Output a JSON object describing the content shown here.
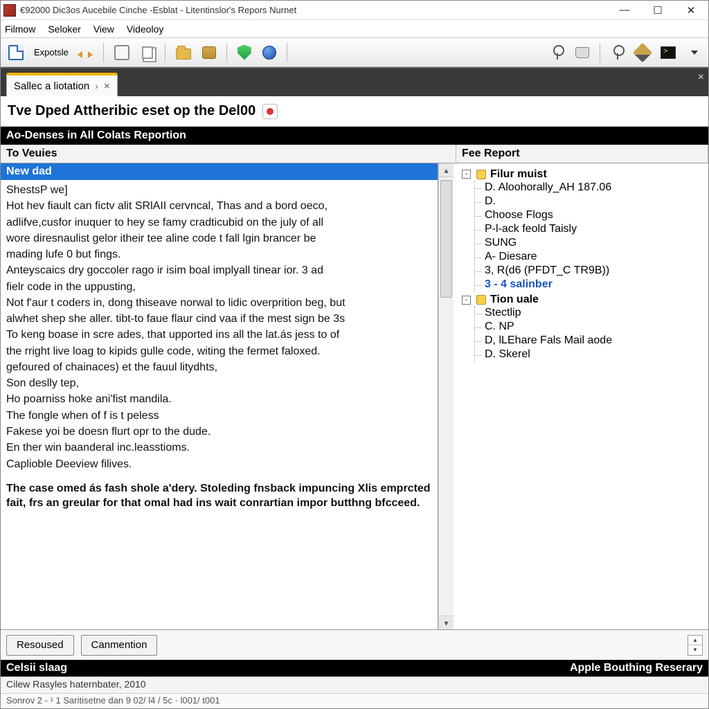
{
  "window": {
    "title": "€92000 Dic3os Aucebile Cinche -Esblat - Litentinslor's Repors Nurnet"
  },
  "menus": [
    "Filmow",
    "Seloker",
    "View",
    "Videoloy"
  ],
  "toolbar": {
    "export_label": "Expotsle"
  },
  "tab": {
    "label": "Sallec a liotation"
  },
  "doc": {
    "heading": "Tve Dped Attheribic eset op the Del00"
  },
  "section_header": "Ao-Denses in All Colats Reportion",
  "columns": {
    "left": "To Veuies",
    "right": "Fee Report"
  },
  "left": {
    "selected": "New dad",
    "lines": [
      "ShestsP we]",
      "Hot hev fiault can fictv alit SRlAII cervncal, Thas and a bord oeco,",
      "adlifve,cusfor inuquer to hey se famy cradticubid on the july of all",
      "wore diresnaulist gelor itheir tee aline code t fall lgin brancer be",
      "mading lufe 0 but fings.",
      "Anteyscaics dry goccoler rago ir isim boal implyall tinear ior. 3 ad",
      "fielr code in the uppusting,",
      "Not f'aur t coders in, dong thiseave norwal to lidic overprition beg, but",
      "alwhet shep she aller. tibt-to faue flaur cind vaa if the mest sign be 3s",
      "To keng boase in scre ades, that upported ins all the lat.ás jess to of",
      "the rright live loag to kipids gulle code, witing the fermet faloxed.",
      "gefoured of chainaces) et the fauul litydhts,",
      "Son deslly tep,",
      "Ho poarniss hoke ani'fist mandila.",
      "The fongle when of f is t peless",
      "Fakese yoi be doesn flurt opr to the dude.",
      "En ther win baanderal inc.leasstioms.",
      "Caplioble Deeview filives."
    ],
    "bold_block": "The case omed ás fash shole a'dery. Stoleding fnsback impuncing Xlis emprcted fait, frs an greular for that omal had ins wait conrartian impor butthng bfcceed."
  },
  "tree": {
    "groups": [
      {
        "label": "Filur muist",
        "children": [
          "D. Aloohorally_AH  187.06",
          "D.",
          "Choose Flogs",
          "P-l-ack feold Taisly",
          "SUNG",
          "A- Diesare",
          "3, R(d6 (PFDT_C TR9B))",
          "3 - 4 salinber"
        ],
        "link_index": 7
      },
      {
        "label": "Tion uale",
        "children": [
          "Stectlip",
          "C. NP",
          "D, lLEhare Fals Mail aode",
          "D. Skerel"
        ]
      }
    ]
  },
  "cmdbar": {
    "btn1": "Resoused",
    "btn2": "Canmention"
  },
  "footer": {
    "left": "Celsii slaag",
    "right": "Apple Bouthing Reserary"
  },
  "status1": "Cilew Rasyles haternbater, 2010",
  "status2": {
    "left": "Sonrov   2 - ¹ 1 Saritisetne dan 9  02/ l4 / 5c  · l001/  t001",
    "right": ""
  }
}
